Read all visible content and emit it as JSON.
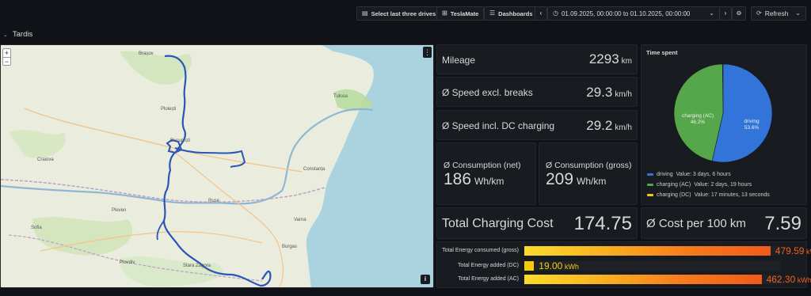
{
  "toolbar": {
    "select_drives": "Select last three drives",
    "teslamate": "TeslaMate",
    "dashboards": "Dashboards",
    "time_range": "01.09.2025, 00:00:00 to 01.10.2025, 00:00:00",
    "refresh": "Refresh"
  },
  "row": {
    "title": "Tardis"
  },
  "map": {
    "labels": [
      "Brașov",
      "Ploiești",
      "București",
      "Craiova",
      "Constanța",
      "Varna",
      "Burgas",
      "Plovdiv",
      "Sofia",
      "Ruse",
      "Pleven",
      "Stara Zagora",
      "Tulcea"
    ],
    "zoom_in": "+",
    "zoom_out": "−",
    "menu": "⋮",
    "info": "i"
  },
  "stats": {
    "mileage": {
      "label": "Mileage",
      "value": "2293",
      "unit": "km"
    },
    "speed_excl": {
      "label": "Ø Speed excl. breaks",
      "value": "29.3",
      "unit": "km/h"
    },
    "speed_incl": {
      "label": "Ø Speed incl. DC charging",
      "value": "29.2",
      "unit": "km/h"
    },
    "cons_net": {
      "label": "Ø Consumption (net)",
      "value": "186",
      "unit": "Wh/km"
    },
    "cons_gross": {
      "label": "Ø Consumption (gross)",
      "value": "209",
      "unit": "Wh/km"
    },
    "charging_cost": {
      "label": "Total Charging Cost",
      "value": "174.75"
    },
    "cost_per_100": {
      "label": "Ø Cost per 100 km",
      "value": "7.59"
    }
  },
  "chart_data": [
    {
      "type": "pie",
      "title": "Time spent",
      "categories": [
        "driving",
        "charging (AC)",
        "charging (DC)"
      ],
      "values": [
        53.6,
        46.2,
        0.2
      ],
      "slice_labels": [
        "driving\n53.6%",
        "charging (AC)\n46.2%"
      ],
      "legend": [
        {
          "name": "driving",
          "text": "Value: 3 days, 6 hours",
          "color": "#3274d9"
        },
        {
          "name": "charging (AC)",
          "text": "Value: 2 days, 19 hours",
          "color": "#56a64b"
        },
        {
          "name": "charging (DC)",
          "text": "Value: 17 minutes, 13 seconds",
          "color": "#f2cc0c"
        }
      ]
    },
    {
      "type": "bar",
      "orientation": "horizontal",
      "categories": [
        "Total Energy consumed (gross)",
        "Total Energy added (DC)",
        "Total Energy added (AC)"
      ],
      "values": [
        479.59,
        19.0,
        462.3
      ],
      "unit": "kWh",
      "xlim": [
        0,
        500
      ]
    }
  ],
  "energy_labels": {
    "gross": {
      "value": "479.59",
      "unit": "kWh"
    },
    "dc": {
      "value": "19.00",
      "unit": "kWh"
    },
    "ac": {
      "value": "462.30",
      "unit": "kWh"
    }
  },
  "pie_labels": {
    "driving": {
      "name": "driving",
      "pct": "53.6%"
    },
    "ac": {
      "name": "charging (AC)",
      "pct": "46.2%"
    }
  },
  "colors": {
    "driving": "#3274d9",
    "ac": "#56a64b",
    "dc": "#f2cc0c",
    "bar_text_orange": "#f55f1d",
    "bar_text_yellow": "#f2cc0c"
  }
}
